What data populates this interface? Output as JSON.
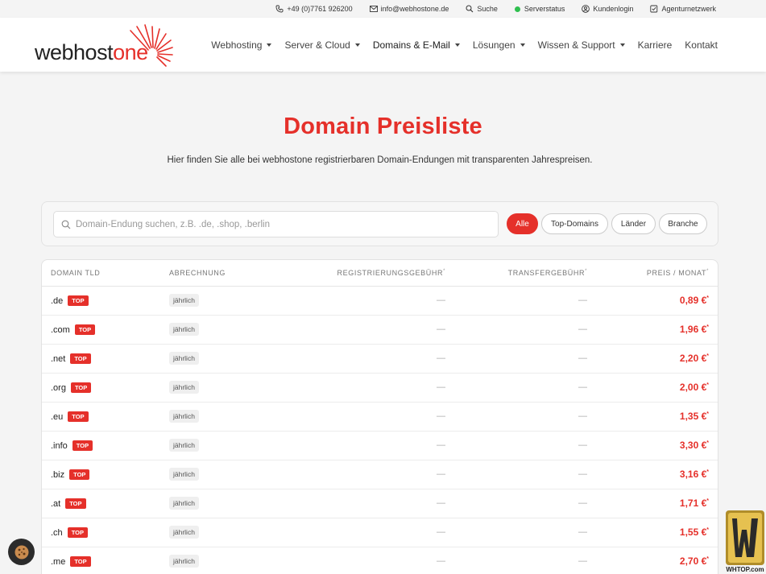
{
  "topbar": {
    "phone": "+49 (0)7761 926200",
    "email": "info@webhostone.de",
    "search": "Suche",
    "status": "Serverstatus",
    "login": "Kundenlogin",
    "agency": "Agenturnetzwerk"
  },
  "brand": {
    "name_part1": "webhost",
    "name_part2": "one",
    "accent": "#e5302a"
  },
  "nav": {
    "items": [
      "Webhosting",
      "Server & Cloud",
      "Domains & E-Mail",
      "Lösungen",
      "Wissen & Support",
      "Karriere",
      "Kontakt"
    ]
  },
  "hero": {
    "title": "Domain Preisliste",
    "subtitle": "Hier finden Sie alle bei webhostone registrierbaren Domain-Endungen mit transparenten Jahrespreisen."
  },
  "filter": {
    "placeholder": "Domain-Endung suchen, z.B. .de, .shop, .berlin",
    "pills": [
      "Alle",
      "Top-Domains",
      "Länder",
      "Branche"
    ],
    "active": "Alle"
  },
  "table": {
    "headers": [
      "Domain TLD",
      "Abrechnung",
      "Registrierungsgebühr",
      "Transfergebühr",
      "Preis / Monat"
    ],
    "asterisk": "*",
    "rows": [
      {
        "tld": ".de",
        "badge": "TOP",
        "billing": "jährlich",
        "reg": "—",
        "transfer": "—",
        "price": "0,89 €"
      },
      {
        "tld": ".com",
        "badge": "TOP",
        "billing": "jährlich",
        "reg": "—",
        "transfer": "—",
        "price": "1,96 €"
      },
      {
        "tld": ".net",
        "badge": "TOP",
        "billing": "jährlich",
        "reg": "—",
        "transfer": "—",
        "price": "2,20 €"
      },
      {
        "tld": ".org",
        "badge": "TOP",
        "billing": "jährlich",
        "reg": "—",
        "transfer": "—",
        "price": "2,00 €"
      },
      {
        "tld": ".eu",
        "badge": "TOP",
        "billing": "jährlich",
        "reg": "—",
        "transfer": "—",
        "price": "1,35 €"
      },
      {
        "tld": ".info",
        "badge": "TOP",
        "billing": "jährlich",
        "reg": "—",
        "transfer": "—",
        "price": "3,30 €"
      },
      {
        "tld": ".biz",
        "badge": "TOP",
        "billing": "jährlich",
        "reg": "—",
        "transfer": "—",
        "price": "3,16 €"
      },
      {
        "tld": ".at",
        "badge": "TOP",
        "billing": "jährlich",
        "reg": "—",
        "transfer": "—",
        "price": "1,71 €"
      },
      {
        "tld": ".ch",
        "badge": "TOP",
        "billing": "jährlich",
        "reg": "—",
        "transfer": "—",
        "price": "1,55 €"
      },
      {
        "tld": ".me",
        "badge": "TOP",
        "billing": "jährlich",
        "reg": "—",
        "transfer": "—",
        "price": "2,70 €"
      }
    ]
  },
  "watermark": {
    "text": "WHTOP.com"
  },
  "icons": [
    "phone-icon",
    "mail-icon",
    "search-icon",
    "status-dot-icon",
    "user-icon",
    "checklist-icon",
    "cookie-icon"
  ]
}
